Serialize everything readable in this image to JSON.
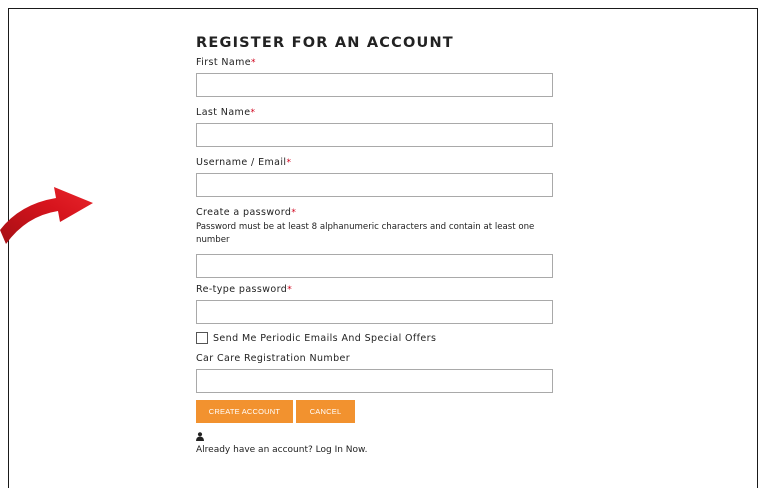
{
  "form": {
    "title": "REGISTER FOR AN ACCOUNT",
    "required_marker": "*",
    "fields": {
      "first_name": {
        "label": "First Name",
        "value": ""
      },
      "last_name": {
        "label": "Last Name",
        "value": ""
      },
      "username": {
        "label": "Username / Email",
        "value": ""
      },
      "password": {
        "label": "Create a password",
        "hint": "Password must be at least 8 alphanumeric characters and contain at least one number",
        "value": ""
      },
      "retype_password": {
        "label": "Re-type password",
        "value": ""
      },
      "car_care": {
        "label": "Car Care Registration Number",
        "value": ""
      }
    },
    "optin": {
      "label": "Send Me Periodic Emails And Special Offers",
      "checked": false
    },
    "buttons": {
      "create": "CREATE ACCOUNT",
      "cancel": "CANCEL"
    },
    "login": {
      "prompt": "Already have an account?",
      "link": "Log In Now",
      "suffix": "."
    }
  },
  "icons": {
    "arrow": "curved-arrow-icon",
    "user": "user-icon"
  },
  "colors": {
    "accent": "#f2922f",
    "required": "#d0021b",
    "arrow": "#d7141d"
  }
}
